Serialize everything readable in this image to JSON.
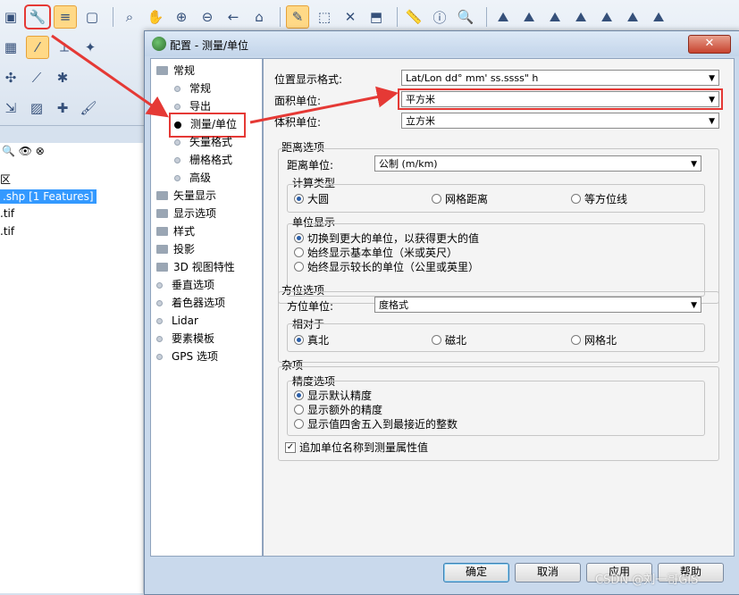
{
  "background_app": {
    "tree_items": [
      "区",
      ".shp [1 Features]",
      ".tif",
      ".tif"
    ]
  },
  "dialog": {
    "title": "配置 - 测量/单位",
    "close_label": "✕",
    "nav": [
      {
        "label": "常规",
        "type": "folder"
      },
      {
        "label": "常规",
        "type": "sub"
      },
      {
        "label": "导出",
        "type": "sub"
      },
      {
        "label": "测量/单位",
        "type": "sub",
        "selected": true
      },
      {
        "label": "矢量格式",
        "type": "sub"
      },
      {
        "label": "栅格格式",
        "type": "sub"
      },
      {
        "label": "高级",
        "type": "sub"
      },
      {
        "label": "矢量显示",
        "type": "folder"
      },
      {
        "label": "显示选项",
        "type": "folder"
      },
      {
        "label": "样式",
        "type": "folder"
      },
      {
        "label": "投影",
        "type": "folder"
      },
      {
        "label": "3D 视图特性",
        "type": "folder"
      },
      {
        "label": "垂直选项",
        "type": "bullet"
      },
      {
        "label": "着色器选项",
        "type": "bullet"
      },
      {
        "label": "Lidar",
        "type": "bullet"
      },
      {
        "label": "要素模板",
        "type": "bullet"
      },
      {
        "label": "GPS 选项",
        "type": "bullet"
      }
    ],
    "position_format_label": "位置显示格式:",
    "position_format_value": "Lat/Lon dd° mm' ss.ssss\" h",
    "area_units_label": "面积单位:",
    "area_units_value": "平方米",
    "volume_units_label": "体积单位:",
    "volume_units_value": "立方米",
    "distance": {
      "group_title": "距离选项",
      "units_label": "距离单位:",
      "units_value": "公制 (m/km)",
      "calc_title": "计算类型",
      "calc_options": [
        "大圆",
        "网格距离",
        "等方位线"
      ],
      "calc_selected": 0,
      "display_title": "单位显示",
      "display_options": [
        "切换到更大的单位，以获得更大的值",
        "始终显示基本单位（米或英尺）",
        "始终显示较长的单位（公里或英里）"
      ],
      "display_selected": 0
    },
    "bearing": {
      "group_title": "方位选项",
      "units_label": "方位单位:",
      "units_value": "度格式",
      "relative_title": "相对于",
      "relative_options": [
        "真北",
        "磁北",
        "网格北"
      ],
      "relative_selected": 0
    },
    "misc": {
      "group_title": "杂项",
      "precision_title": "精度选项",
      "precision_options": [
        "显示默认精度",
        "显示额外的精度",
        "显示值四舍五入到最接近的整数"
      ],
      "precision_selected": 0,
      "checkbox_label": "追加单位名称到测量属性值",
      "checkbox_checked": true
    },
    "buttons": {
      "ok": "确定",
      "cancel": "取消",
      "apply": "应用",
      "help": "帮助"
    }
  },
  "watermark": "CSDN @刘一哥GIS",
  "colors": {
    "annotation_red": "#e53935",
    "selection_blue": "#3399ff"
  }
}
